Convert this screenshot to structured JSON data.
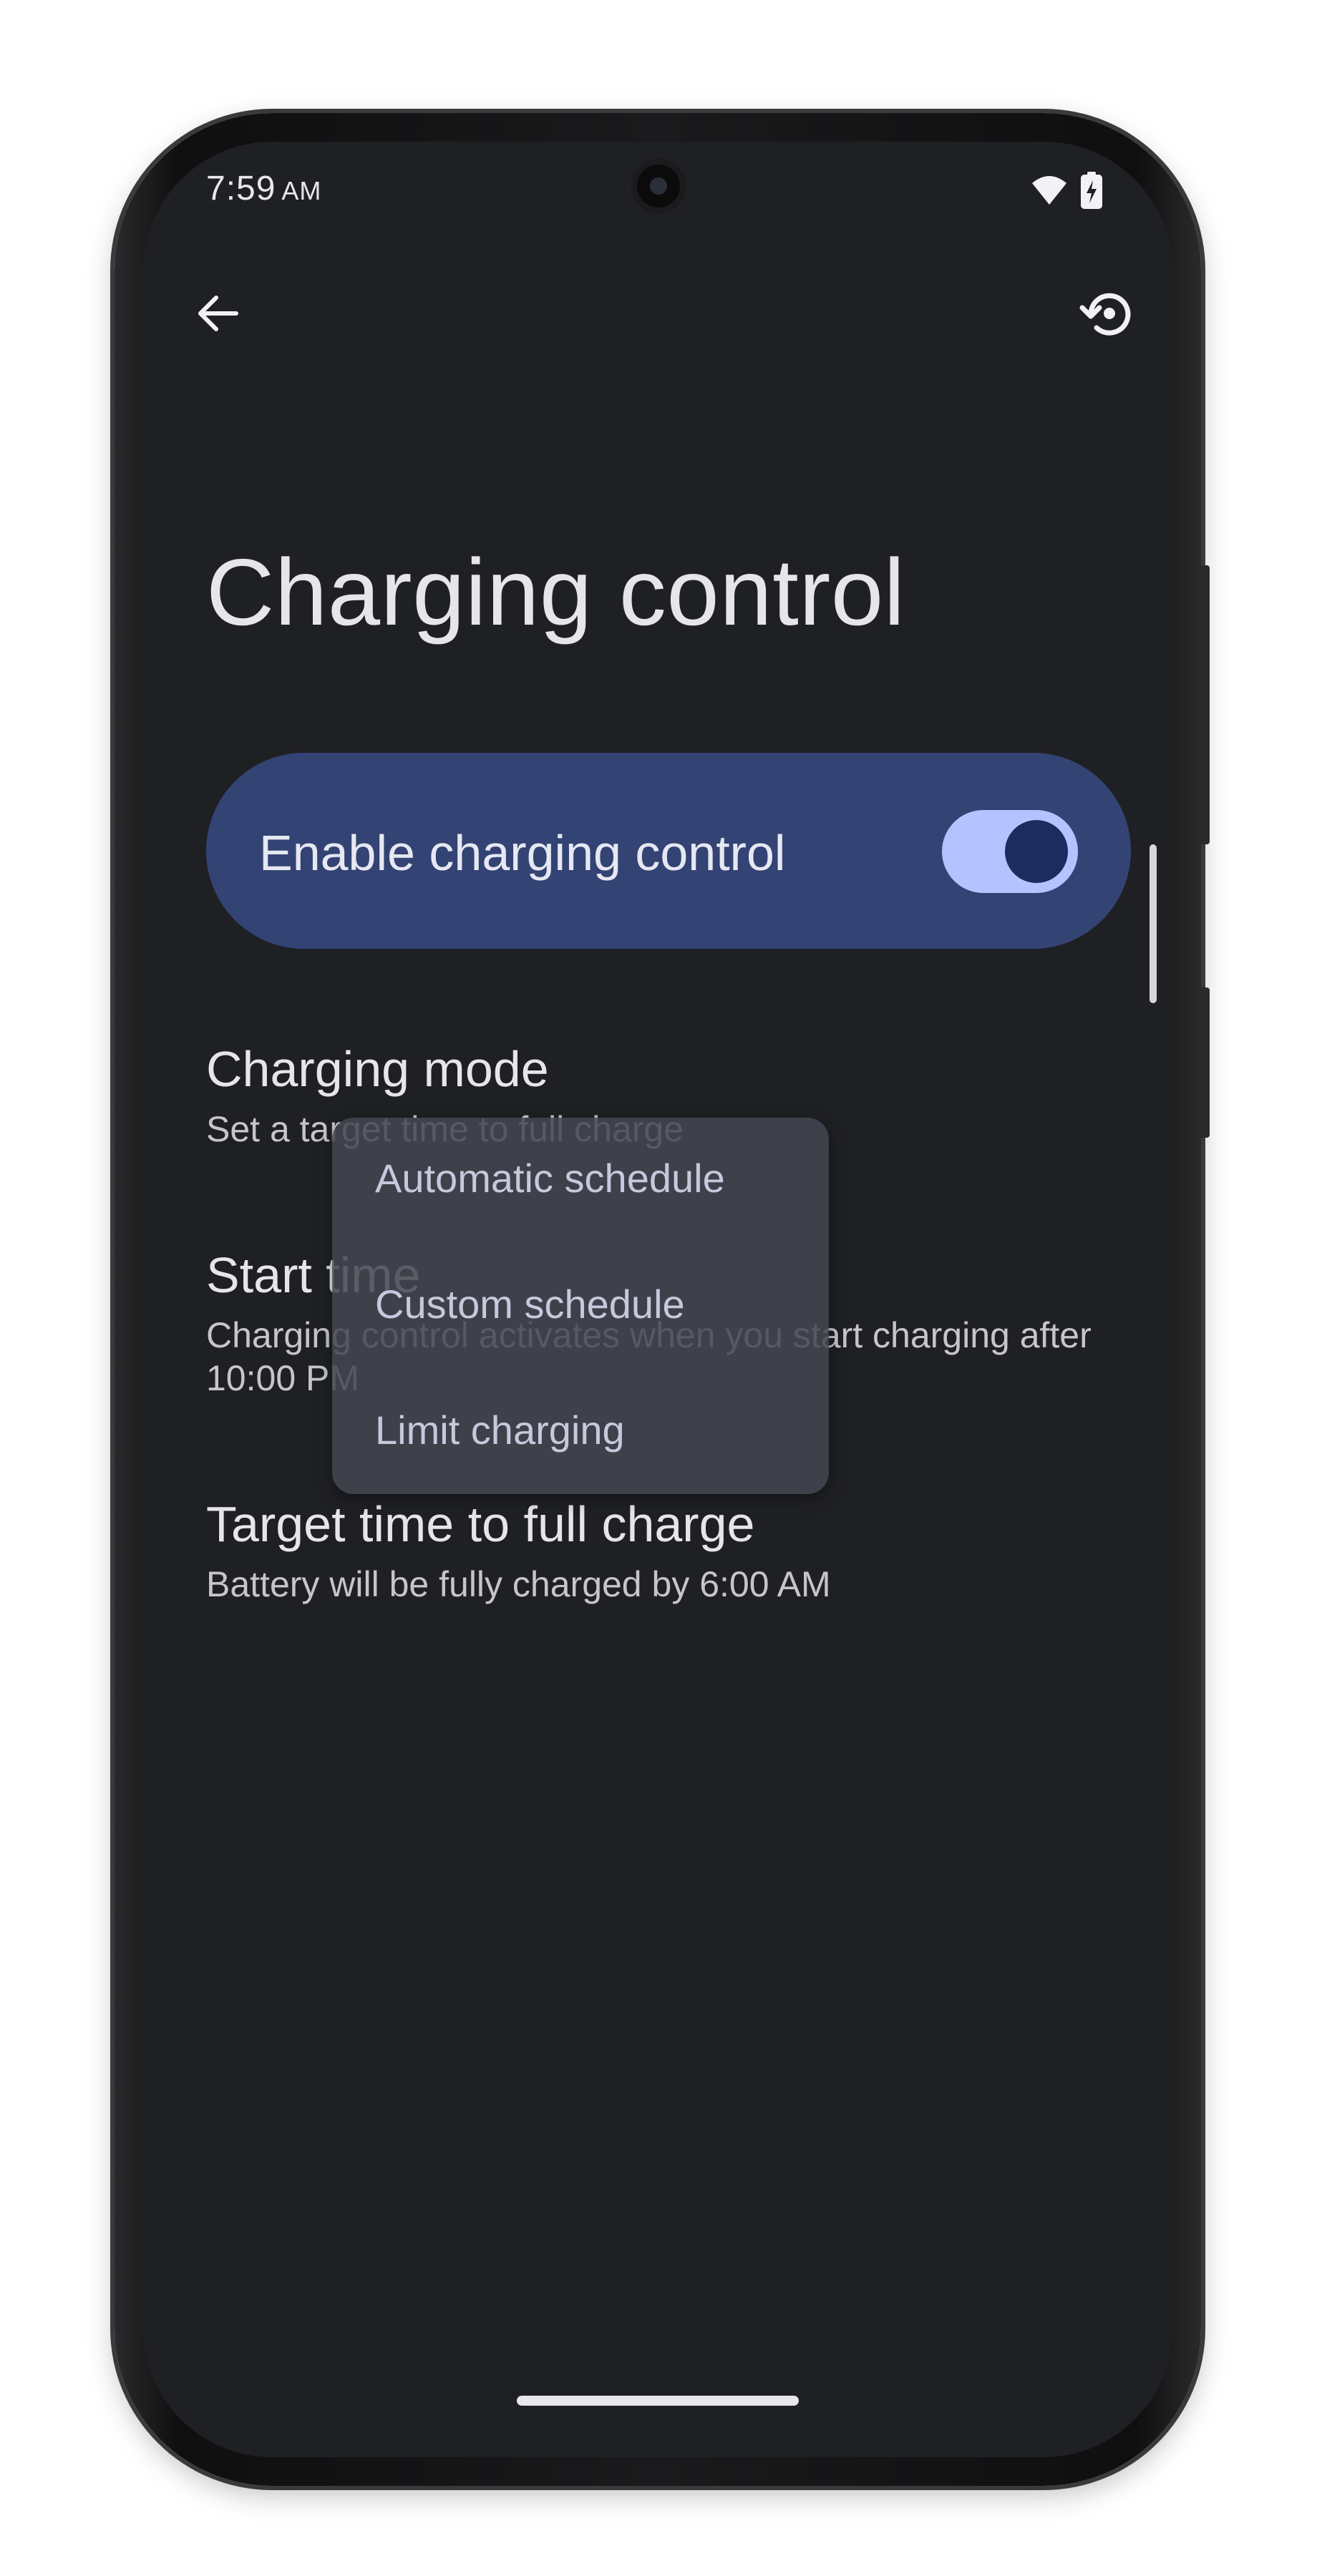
{
  "status_bar": {
    "time": "7:59",
    "ampm": "AM",
    "icons": [
      "wifi-icon",
      "battery-charging-icon"
    ]
  },
  "top_bar": {
    "back_icon": "arrow-left-icon",
    "reset_icon": "restore-icon"
  },
  "page": {
    "title": "Charging control"
  },
  "enable_card": {
    "label": "Enable charging control",
    "toggle_on": true
  },
  "preferences": [
    {
      "title": "Charging mode",
      "summary": "Set a target time to full charge"
    },
    {
      "title": "Start time",
      "summary": "Charging control activates when you start charging after 10:00 PM"
    },
    {
      "title": "Target time to full charge",
      "summary": "Battery will be fully charged by 6:00 AM"
    }
  ],
  "dropdown_menu": {
    "items": [
      {
        "label": "Automatic schedule"
      },
      {
        "label": "Custom schedule"
      },
      {
        "label": "Limit charging"
      }
    ]
  },
  "colors": {
    "background": "#1f2024",
    "card": "#334374",
    "toggle_track": "#b4c3ff",
    "toggle_thumb": "#1d2c5e",
    "menu": "#444650"
  }
}
